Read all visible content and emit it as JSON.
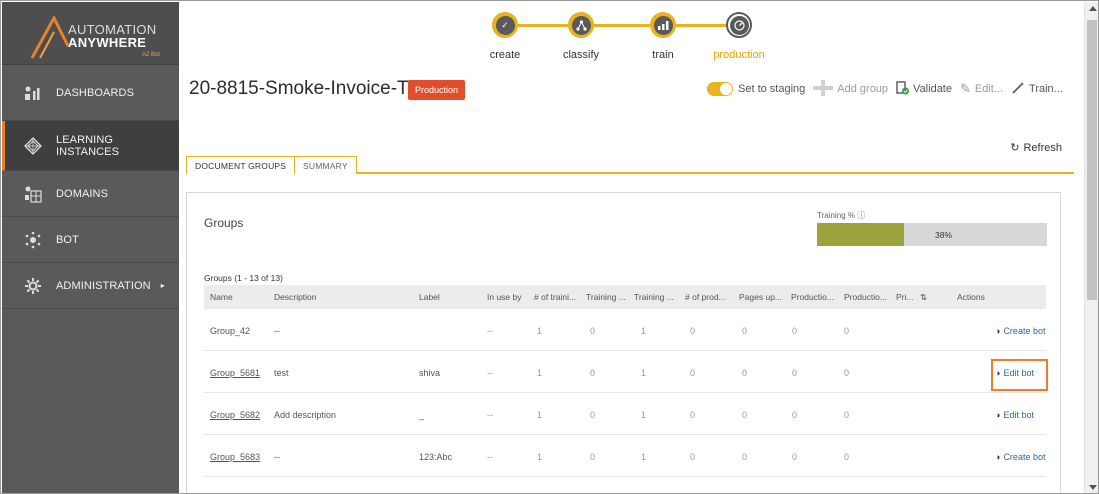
{
  "logo": {
    "line1": "AUTOMATION",
    "line2": "ANYWHERE",
    "line3": "A2 Bot"
  },
  "sidebar": {
    "items": [
      {
        "label": "DASHBOARDS",
        "icon": "dashboard-icon"
      },
      {
        "label": "LEARNING INSTANCES",
        "icon": "learning-instances-icon",
        "active": true
      },
      {
        "label": "DOMAINS",
        "icon": "domains-icon"
      },
      {
        "label": "BOT",
        "icon": "bot-icon"
      },
      {
        "label": "ADMINISTRATION",
        "icon": "administration-icon",
        "arrow": "▸"
      }
    ]
  },
  "stepper": {
    "steps": [
      {
        "label": "create",
        "icon": "check-icon"
      },
      {
        "label": "classify",
        "icon": "classify-icon"
      },
      {
        "label": "train",
        "icon": "train-icon"
      },
      {
        "label": "production",
        "icon": "gauge-icon",
        "current": true
      }
    ]
  },
  "header": {
    "title": "20-8815-Smoke-Invoice-T4",
    "badge": "Production"
  },
  "toolbar": {
    "set_to_staging": "Set to staging",
    "add_group": "Add group",
    "validate": "Validate",
    "edit": "Edit...",
    "train": "Train..."
  },
  "refresh": "Refresh",
  "tabs": {
    "document_groups": "DOCUMENT GROUPS",
    "summary": "SUMMARY"
  },
  "groups": {
    "title": "Groups",
    "training_label": "Training %",
    "training_percent": 38,
    "training_text": "38%",
    "count": "Groups (1 - 13 of 13)",
    "columns": [
      "Name",
      "Description",
      "Label",
      "In use by",
      "# of traini...",
      "Training ...",
      "Training ...",
      "# of prod...",
      "Pages up...",
      "Productio...",
      "Productio...",
      "Pri...",
      "Actions"
    ],
    "rows": [
      {
        "name": "Group_42",
        "description": "--",
        "label": "",
        "in_use_by": "--",
        "num_training": "1",
        "training_a": "0",
        "training_b": "1",
        "num_prod": "0",
        "pages_up": "0",
        "prod_a": "0",
        "prod_b": "0",
        "action": "Create bot",
        "link": false
      },
      {
        "name": "Group_5681",
        "description": "test",
        "label": "shiva",
        "in_use_by": "--",
        "num_training": "1",
        "training_a": "0",
        "training_b": "1",
        "num_prod": "0",
        "pages_up": "0",
        "prod_a": "0",
        "prod_b": "0",
        "action": "Edit bot",
        "link": true
      },
      {
        "name": "Group_5682",
        "description": "Add description",
        "label": "_",
        "in_use_by": "--",
        "num_training": "1",
        "training_a": "0",
        "training_b": "1",
        "num_prod": "0",
        "pages_up": "0",
        "prod_a": "0",
        "prod_b": "0",
        "action": "Edit bot",
        "link": true
      },
      {
        "name": "Group_5683",
        "description": "--",
        "label": "123:Abc",
        "in_use_by": "--",
        "num_training": "1",
        "training_a": "0",
        "training_b": "1",
        "num_prod": "0",
        "pages_up": "0",
        "prod_a": "0",
        "prod_b": "0",
        "action": "Create bot",
        "link": true
      }
    ]
  },
  "colors": {
    "accent": "#e9b21f",
    "badge": "#e04e2c",
    "sidebar": "#5a5a5a",
    "highlight": "#ef7c2b",
    "training_fill": "#9aa43a"
  }
}
